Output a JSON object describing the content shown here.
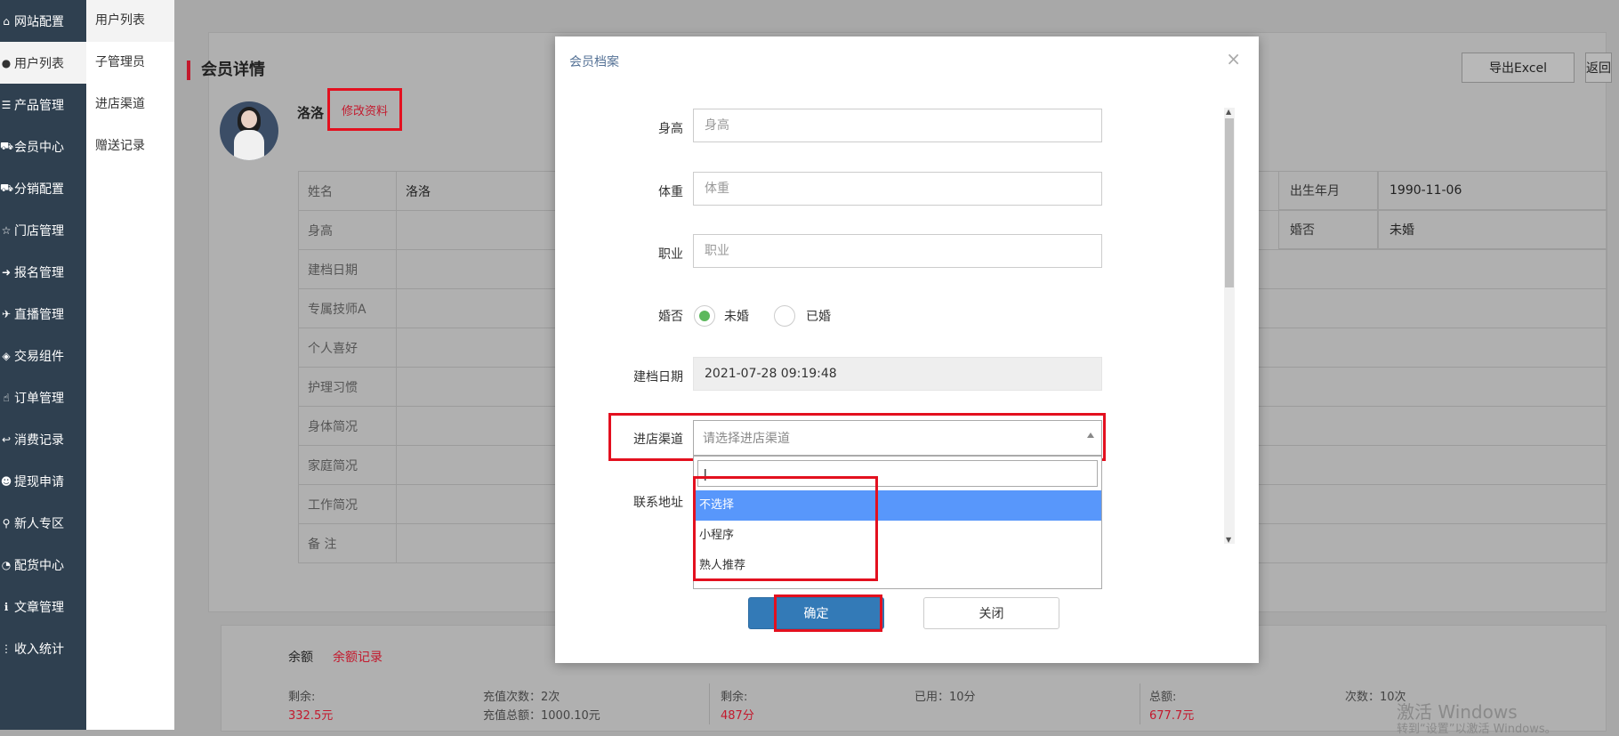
{
  "sidebar": {
    "items": [
      {
        "icon": "home-icon",
        "glyph": "⌂",
        "label": "网站配置"
      },
      {
        "icon": "user-icon",
        "glyph": "●",
        "label": "用户列表"
      },
      {
        "icon": "list-icon",
        "glyph": "☰",
        "label": "产品管理"
      },
      {
        "icon": "cart-icon",
        "glyph": "⛟",
        "label": "会员中心"
      },
      {
        "icon": "truck-icon",
        "glyph": "⛟",
        "label": "分销配置"
      },
      {
        "icon": "star-icon",
        "glyph": "☆",
        "label": "门店管理"
      },
      {
        "icon": "arrow-right-icon",
        "glyph": "➜",
        "label": "报名管理"
      },
      {
        "icon": "plane-icon",
        "glyph": "✈",
        "label": "直播管理"
      },
      {
        "icon": "ticket-icon",
        "glyph": "◈",
        "label": "交易组件"
      },
      {
        "icon": "hand-icon",
        "glyph": "☝",
        "label": "订单管理"
      },
      {
        "icon": "reply-icon",
        "glyph": "↩",
        "label": "消费记录"
      },
      {
        "icon": "users-icon",
        "glyph": "☻",
        "label": "提现申请"
      },
      {
        "icon": "pin-icon",
        "glyph": "⚲",
        "label": "新人专区"
      },
      {
        "icon": "pie-icon",
        "glyph": "◔",
        "label": "配货中心"
      },
      {
        "icon": "info-icon",
        "glyph": "ℹ",
        "label": "文章管理"
      },
      {
        "icon": "signal-icon",
        "glyph": "⋮",
        "label": "收入统计"
      }
    ]
  },
  "subnav": {
    "items": [
      "用户列表",
      "子管理员",
      "进店渠道",
      "赠送记录"
    ]
  },
  "page": {
    "title": "会员详情",
    "member_name": "洛洛",
    "edit_label": "修改资料",
    "export_label": "导出Excel",
    "back_label": "返回"
  },
  "info_table": {
    "rows": [
      {
        "label": "姓名",
        "value": "洛洛"
      },
      {
        "label": "身高",
        "value": ""
      },
      {
        "label": "建档日期",
        "value": ""
      },
      {
        "label": "专属技师A",
        "value": ""
      },
      {
        "label": "个人喜好",
        "value": ""
      },
      {
        "label": "护理习惯",
        "value": ""
      },
      {
        "label": "身体简况",
        "value": ""
      },
      {
        "label": "家庭简况",
        "value": ""
      },
      {
        "label": "工作简况",
        "value": ""
      },
      {
        "label": "备 注",
        "value": ""
      }
    ],
    "right": [
      {
        "label": "出生年月",
        "value": "1990-11-06"
      },
      {
        "label": "婚否",
        "value": "未婚"
      }
    ]
  },
  "balance": {
    "title": "余额",
    "link": "余额记录",
    "stats": {
      "remain_label": "剩余:",
      "remain_value": "332.5元",
      "recharge_count": "充值次数：2次",
      "recharge_total": "充值总额：1000.10元",
      "points_remain_label": "剩余:",
      "points_remain_value": "487分",
      "points_used": "已用：10分",
      "total_label": "总额:",
      "total_value": "677.7元",
      "times": "次数：10次"
    }
  },
  "watermark": {
    "line1": "激活 Windows",
    "line2": "转到“设置”以激活 Windows。"
  },
  "modal": {
    "title": "会员档案",
    "close_glyph": "×",
    "fields": {
      "height_label": "身高",
      "height_placeholder": "身高",
      "weight_label": "体重",
      "weight_placeholder": "体重",
      "job_label": "职业",
      "job_placeholder": "职业",
      "married_label": "婚否",
      "married_options": [
        "未婚",
        "已婚"
      ],
      "married_selected": "未婚",
      "created_label": "建档日期",
      "created_value": "2021-07-28 09:19:48",
      "channel_label": "进店渠道",
      "channel_placeholder": "请选择进店渠道",
      "address_label": "联系地址"
    },
    "dropdown": {
      "search_value": "|",
      "options": [
        "不选择",
        "小程序",
        "熟人推荐"
      ],
      "selected": "不选择"
    },
    "confirm_label": "确定",
    "close_label": "关闭"
  },
  "colors": {
    "accent": "#c3192d",
    "primary": "#337ab7",
    "highlight": "#e3101f",
    "sidebar": "#2f4050",
    "option_selected": "#5897fb",
    "radio_checked": "#5cb85c"
  }
}
